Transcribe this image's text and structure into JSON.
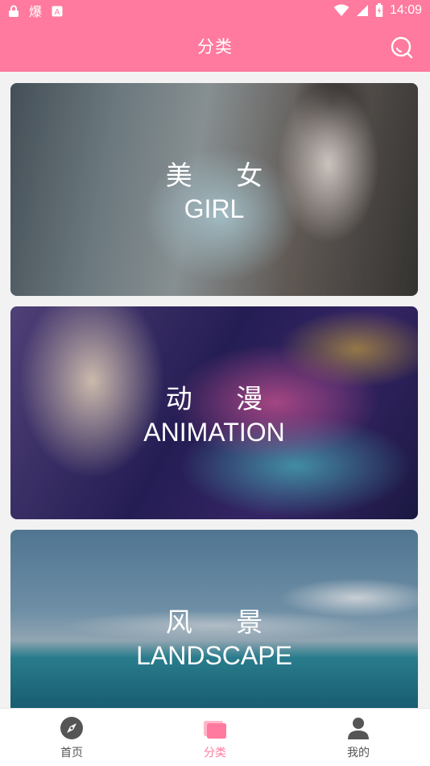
{
  "status_bar": {
    "time": "14:09",
    "left_icons": [
      "lock-icon",
      "app-notification-icon",
      "a-icon"
    ],
    "right_icons": [
      "wifi-icon",
      "signal-icon",
      "battery-icon"
    ]
  },
  "header": {
    "title": "分类",
    "search_icon": "search-icon"
  },
  "categories": [
    {
      "cn": "美 女",
      "en": "GIRL"
    },
    {
      "cn": "动 漫",
      "en": "ANIMATION"
    },
    {
      "cn": "风 景",
      "en": "LANDSCAPE"
    }
  ],
  "bottom_nav": [
    {
      "label": "首页",
      "icon": "compass-icon",
      "active": false
    },
    {
      "label": "分类",
      "icon": "cards-icon",
      "active": true
    },
    {
      "label": "我的",
      "icon": "person-icon",
      "active": false
    }
  ],
  "colors": {
    "accent": "#ff7a9e",
    "inactive": "#555555"
  }
}
